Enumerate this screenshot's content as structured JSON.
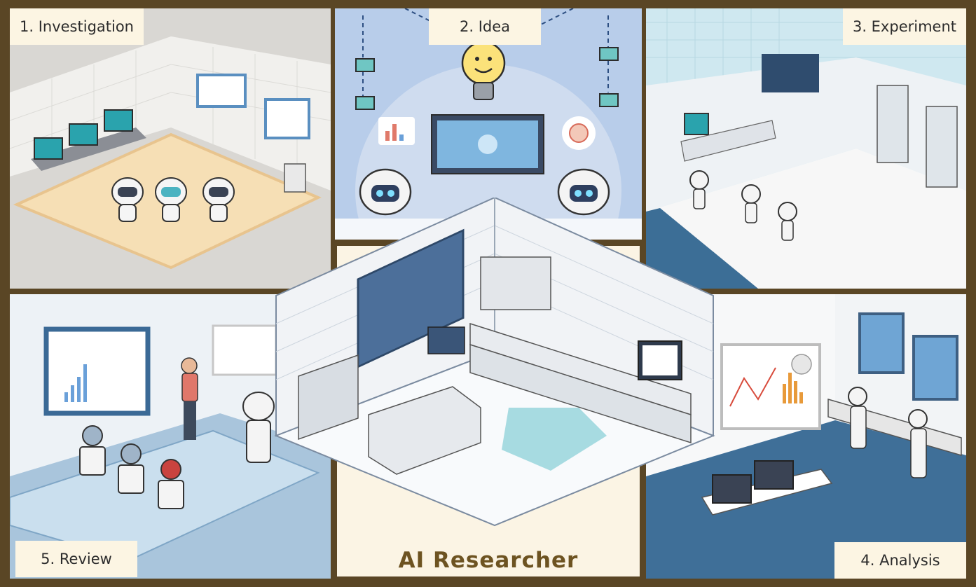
{
  "panels": {
    "investigation": {
      "label": "1. Investigation"
    },
    "idea": {
      "label": "2. Idea"
    },
    "experiment": {
      "label": "3. Experiment"
    },
    "analysis": {
      "label": "4. Analysis"
    },
    "review": {
      "label": "5. Review"
    }
  },
  "center": {
    "title": "AI Researcher"
  },
  "colors": {
    "frame": "#5a4625",
    "label_bg": "#fcf5e3",
    "title": "#6d5321",
    "idea_bg": "#b8cdea",
    "floor_blue": "#3f6f98"
  },
  "icons": [
    "robot-icon",
    "lightbulb-icon",
    "monitor-icon",
    "chart-icon"
  ]
}
